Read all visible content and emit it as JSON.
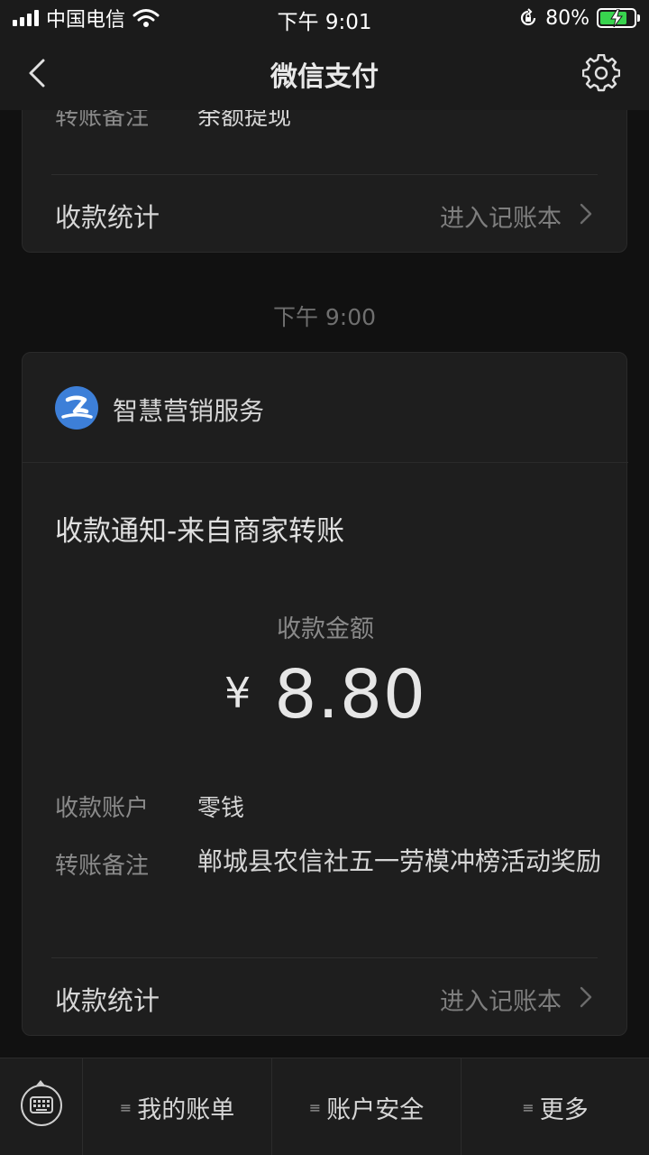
{
  "status_bar": {
    "carrier": "中国电信",
    "time": "下午 9:01",
    "battery_percent": "80%",
    "battery_level": 0.8,
    "icons": [
      "signal-icon",
      "wifi-icon",
      "orientation-lock-icon",
      "battery-charging-icon"
    ]
  },
  "nav": {
    "title": "微信支付",
    "back_icon": "back-chevron-icon",
    "settings_icon": "gear-icon"
  },
  "previous_message": {
    "remark_label": "转账备注",
    "remark_value": "余额提现",
    "stats_label": "收款统计",
    "stats_link": "进入记账本"
  },
  "timestamp": "下午 9:00",
  "message": {
    "service_name": "智慧营销服务",
    "service_logo_icon": "service-logo-icon",
    "title": "收款通知-来自商家转账",
    "amount_label": "收款金额",
    "currency": "¥",
    "amount": "8.80",
    "account_label": "收款账户",
    "account_value": "零钱",
    "remark_label": "转账备注",
    "remark_value": "郸城县农信社五一劳模冲榜活动奖励",
    "stats_label": "收款统计",
    "stats_link": "进入记账本"
  },
  "bottom_bar": {
    "keyboard_icon": "keyboard-icon",
    "menu": [
      {
        "label": "我的账单"
      },
      {
        "label": "账户安全"
      },
      {
        "label": "更多"
      }
    ]
  },
  "colors": {
    "background": "#111111",
    "card": "#1e1e1e",
    "battery_fill": "#38d34e",
    "logo_blue": "#3d7fd8"
  }
}
